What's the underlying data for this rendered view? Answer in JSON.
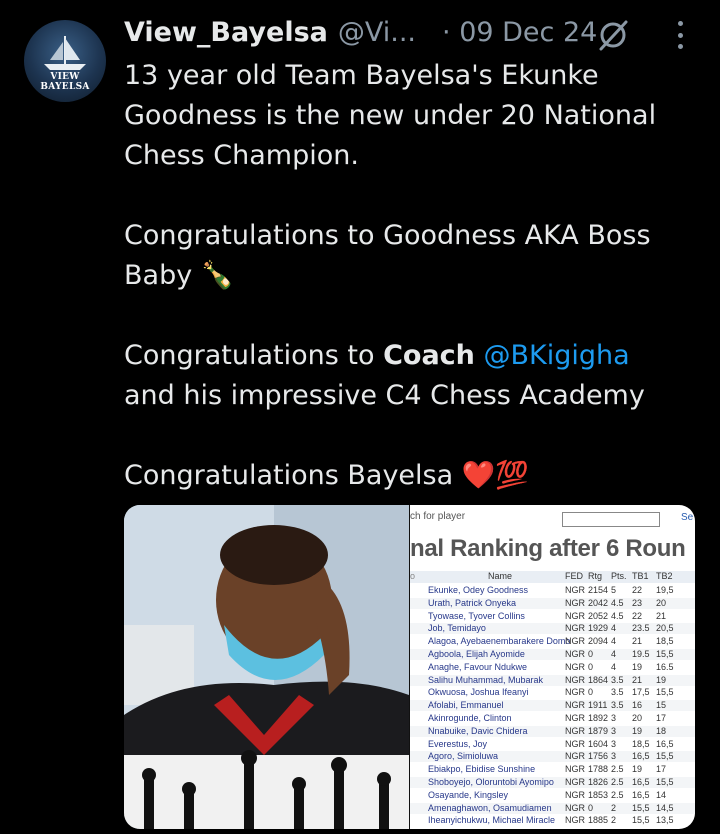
{
  "post": {
    "author_name": "View_Bayelsa",
    "author_handle": "@Vi...",
    "separator": "·",
    "date": "09 Dec 24",
    "avatar_text": "VIEW BAYELSA",
    "body": {
      "line1": "13 year old Team Bayelsa's Ekunke Goodness is the new under 20 National Chess Champion.",
      "line2": "Congratulations to Goodness AKA Boss Baby 🍾",
      "line3_prefix": "Congratulations to ",
      "line3_bold": "Coach",
      "line3_mention": "@BKigigha",
      "line3_suffix": "and his impressive C4 Chess Academy",
      "line4": "Congratulations Bayelsa ❤️💯"
    }
  },
  "screenshot": {
    "search_label": "ch for player",
    "search_button": "Se",
    "title": "nal Ranking after 6 Roun",
    "headers": {
      "no": "o",
      "name": "Name",
      "fed": "FED",
      "rtg": "Rtg",
      "pts": "Pts.",
      "tb1": "TB1",
      "tb2": "TB2"
    },
    "rows": [
      {
        "no": "",
        "name": "Ekunke, Odey Goodness",
        "fed": "NGR",
        "rtg": "2154",
        "pts": "5",
        "tb1": "22",
        "tb2": "19,5"
      },
      {
        "no": "",
        "name": "Urath, Patrick Onyeka",
        "fed": "NGR",
        "rtg": "2042",
        "pts": "4.5",
        "tb1": "23",
        "tb2": "20"
      },
      {
        "no": "",
        "name": "Tyowase, Tyover Collins",
        "fed": "NGR",
        "rtg": "2052",
        "pts": "4.5",
        "tb1": "22",
        "tb2": "21"
      },
      {
        "no": "",
        "name": "Job, Temidayo",
        "fed": "NGR",
        "rtg": "1929",
        "pts": "4",
        "tb1": "23.5",
        "tb2": "20,5"
      },
      {
        "no": "",
        "name": "Alagoa, Ayebaenembarakere Domo",
        "fed": "NGR",
        "rtg": "2094",
        "pts": "4",
        "tb1": "21",
        "tb2": "18,5"
      },
      {
        "no": "",
        "name": "Agboola, Elijah Ayomide",
        "fed": "NGR",
        "rtg": "0",
        "pts": "4",
        "tb1": "19.5",
        "tb2": "15,5"
      },
      {
        "no": "",
        "name": "Anaghe, Favour Ndukwe",
        "fed": "NGR",
        "rtg": "0",
        "pts": "4",
        "tb1": "19",
        "tb2": "16.5"
      },
      {
        "no": "",
        "name": "Salihu Muhammad, Mubarak",
        "fed": "NGR",
        "rtg": "1864",
        "pts": "3.5",
        "tb1": "21",
        "tb2": "19"
      },
      {
        "no": "",
        "name": "Okwuosa, Joshua Ifeanyi",
        "fed": "NGR",
        "rtg": "0",
        "pts": "3.5",
        "tb1": "17,5",
        "tb2": "15,5"
      },
      {
        "no": "",
        "name": "Afolabi, Emmanuel",
        "fed": "NGR",
        "rtg": "1911",
        "pts": "3.5",
        "tb1": "16",
        "tb2": "15"
      },
      {
        "no": "",
        "name": "Akinrogunde, Clinton",
        "fed": "NGR",
        "rtg": "1892",
        "pts": "3",
        "tb1": "20",
        "tb2": "17"
      },
      {
        "no": "",
        "name": "Nnabuike, Davic Chidera",
        "fed": "NGR",
        "rtg": "1879",
        "pts": "3",
        "tb1": "19",
        "tb2": "18"
      },
      {
        "no": "",
        "name": "Everestus, Joy",
        "fed": "NGR",
        "rtg": "1604",
        "pts": "3",
        "tb1": "18,5",
        "tb2": "16,5"
      },
      {
        "no": "",
        "name": "Agoro, Simioluwa",
        "fed": "NGR",
        "rtg": "1756",
        "pts": "3",
        "tb1": "16,5",
        "tb2": "15,5"
      },
      {
        "no": "",
        "name": "Ebiakpo, Ebidise Sunshine",
        "fed": "NGR",
        "rtg": "1788",
        "pts": "2.5",
        "tb1": "19",
        "tb2": "17"
      },
      {
        "no": "",
        "name": "Shoboyejo, Oloruntobi Ayomipo",
        "fed": "NGR",
        "rtg": "1826",
        "pts": "2.5",
        "tb1": "16,5",
        "tb2": "15,5"
      },
      {
        "no": "",
        "name": "Osayande, Kingsley",
        "fed": "NGR",
        "rtg": "1853",
        "pts": "2.5",
        "tb1": "16,5",
        "tb2": "14"
      },
      {
        "no": "",
        "name": "Amenaghawon, Osamudiamen",
        "fed": "NGR",
        "rtg": "0",
        "pts": "2",
        "tb1": "15,5",
        "tb2": "14,5"
      },
      {
        "no": "",
        "name": "Iheanyichukwu, Michael Miracle",
        "fed": "NGR",
        "rtg": "1885",
        "pts": "2",
        "tb1": "15,5",
        "tb2": "13,5"
      }
    ]
  },
  "colors": {
    "background": "#000000",
    "text": "#e7e9ea",
    "muted": "#8b98a5",
    "link": "#1d9bf0"
  },
  "icons": {
    "grok": "grok-icon",
    "more": "more-dots-icon"
  }
}
